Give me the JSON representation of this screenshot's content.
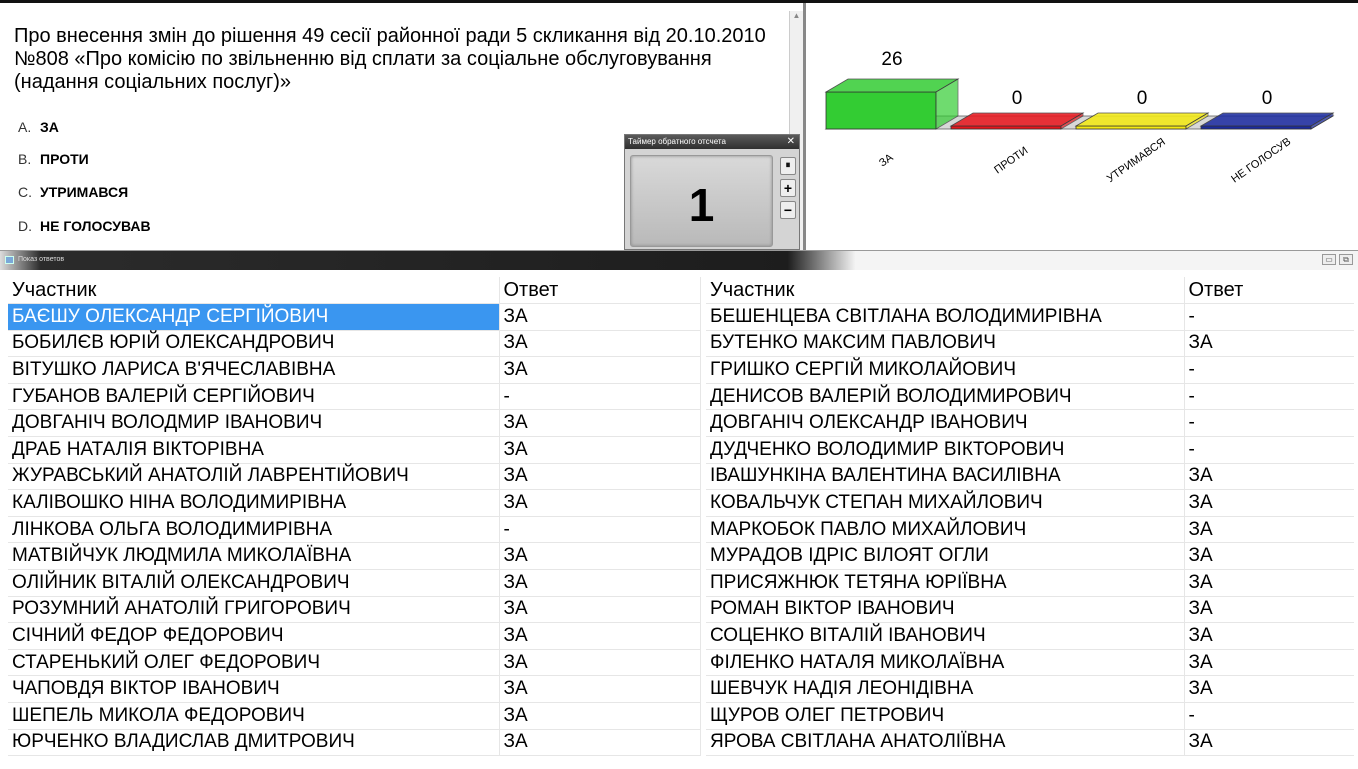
{
  "question": {
    "text": "Про внесення змін до рішення 49 сесії районної ради 5 скликання від 20.10.2010 №808 «Про комісію по звільненню від сплати за соціальне обслуговування (надання соціальних послуг)»",
    "options": [
      {
        "letter": "A.",
        "label": "ЗА"
      },
      {
        "letter": "B.",
        "label": "ПРОТИ"
      },
      {
        "letter": "C.",
        "label": "УТРИМАВСЯ"
      },
      {
        "letter": "D.",
        "label": "НЕ ГОЛОСУВАВ"
      }
    ]
  },
  "timer": {
    "title": "Таймер обратного отсчета",
    "close_icon": "✕",
    "value": "1",
    "pause_label": "⏸",
    "plus_label": "+",
    "minus_label": "−"
  },
  "chart_data": {
    "type": "bar",
    "categories": [
      "ЗА",
      "ПРОТИ",
      "УТРИМАВСЯ",
      "НЕ ГОЛОСУВ"
    ],
    "values": [
      26,
      0,
      0,
      0
    ],
    "colors": [
      "#33cc33",
      "#e8141b",
      "#f4ea10",
      "#1a2aa0"
    ],
    "data_labels": [
      "26",
      "0",
      "0",
      "0"
    ],
    "title": "",
    "xlabel": "",
    "ylabel": "",
    "ylim": [
      0,
      26
    ],
    "grid": false,
    "legend": "none",
    "style": "3d"
  },
  "answers_window": {
    "title": "Показ ответов",
    "minimize_icon": "minimize-icon",
    "maximize_icon": "maximize-icon",
    "columns": [
      "Участник",
      "Ответ",
      "Участник",
      "Ответ"
    ],
    "left_rows": [
      {
        "name": "БАЄШУ ОЛЕКСАНДР СЕРГІЙОВИЧ",
        "answer": "ЗА",
        "selected": true
      },
      {
        "name": "БОБИЛЄВ ЮРІЙ ОЛЕКСАНДРОВИЧ",
        "answer": "ЗА"
      },
      {
        "name": "ВІТУШКО ЛАРИСА В'ЯЧЕСЛАВІВНА",
        "answer": "ЗА"
      },
      {
        "name": "ГУБАНОВ ВАЛЕРІЙ СЕРГІЙОВИЧ",
        "answer": "-"
      },
      {
        "name": "ДОВГАНІЧ ВОЛОДМИР ІВАНОВИЧ",
        "answer": "ЗА"
      },
      {
        "name": "ДРАБ НАТАЛІЯ ВІКТОРІВНА",
        "answer": "ЗА"
      },
      {
        "name": "ЖУРАВСЬКИЙ АНАТОЛІЙ ЛАВРЕНТІЙОВИЧ",
        "answer": "ЗА"
      },
      {
        "name": "КАЛІВОШКО НІНА ВОЛОДИМИРІВНА",
        "answer": "ЗА"
      },
      {
        "name": "ЛІНКОВА ОЛЬГА ВОЛОДИМИРІВНА",
        "answer": "-"
      },
      {
        "name": "МАТВІЙЧУК ЛЮДМИЛА МИКОЛАЇВНА",
        "answer": "ЗА"
      },
      {
        "name": "ОЛІЙНИК ВІТАЛІЙ ОЛЕКСАНДРОВИЧ",
        "answer": "ЗА"
      },
      {
        "name": "РОЗУМНИЙ АНАТОЛІЙ ГРИГОРОВИЧ",
        "answer": "ЗА"
      },
      {
        "name": "СІЧНИЙ ФЕДОР ФЕДОРОВИЧ",
        "answer": "ЗА"
      },
      {
        "name": "СТАРЕНЬКИЙ ОЛЕГ ФЕДОРОВИЧ",
        "answer": "ЗА"
      },
      {
        "name": "ЧАПОВДЯ ВІКТОР ІВАНОВИЧ",
        "answer": "ЗА"
      },
      {
        "name": "ШЕПЕЛЬ МИКОЛА ФЕДОРОВИЧ",
        "answer": "ЗА"
      },
      {
        "name": "ЮРЧЕНКО ВЛАДИСЛАВ ДМИТРОВИЧ",
        "answer": "ЗА"
      }
    ],
    "right_rows": [
      {
        "name": "БЕШЕНЦЕВА СВІТЛАНА ВОЛОДИМИРІВНА",
        "answer": "-"
      },
      {
        "name": "БУТЕНКО МАКСИМ ПАВЛОВИЧ",
        "answer": "ЗА"
      },
      {
        "name": "ГРИШКО СЕРГІЙ МИКОЛАЙОВИЧ",
        "answer": "-"
      },
      {
        "name": "ДЕНИСОВ ВАЛЕРІЙ ВОЛОДИМИРОВИЧ",
        "answer": "-"
      },
      {
        "name": "ДОВГАНІЧ ОЛЕКСАНДР ІВАНОВИЧ",
        "answer": "-"
      },
      {
        "name": "ДУДЧЕНКО ВОЛОДИМИР ВІКТОРОВИЧ",
        "answer": "-"
      },
      {
        "name": "ІВАШУНКІНА ВАЛЕНТИНА ВАСИЛІВНА",
        "answer": "ЗА"
      },
      {
        "name": "КОВАЛЬЧУК СТЕПАН МИХАЙЛОВИЧ",
        "answer": "ЗА"
      },
      {
        "name": "МАРКОБОК ПАВЛО МИХАЙЛОВИЧ",
        "answer": "ЗА"
      },
      {
        "name": "МУРАДОВ ІДРІС ВІЛОЯТ ОГЛИ",
        "answer": "ЗА"
      },
      {
        "name": "ПРИСЯЖНЮК ТЕТЯНА ЮРІЇВНА",
        "answer": "ЗА"
      },
      {
        "name": "РОМАН ВІКТОР ІВАНОВИЧ",
        "answer": "ЗА"
      },
      {
        "name": "СОЦЕНКО ВІТАЛІЙ ІВАНОВИЧ",
        "answer": "ЗА"
      },
      {
        "name": "ФІЛЕНКО НАТАЛЯ МИКОЛАЇВНА",
        "answer": "ЗА"
      },
      {
        "name": "ШЕВЧУК НАДІЯ ЛЕОНІДІВНА",
        "answer": "ЗА"
      },
      {
        "name": "ЩУРОВ ОЛЕГ ПЕТРОВИЧ",
        "answer": "-"
      },
      {
        "name": "ЯРОВА СВІТЛАНА АНАТОЛІЇВНА",
        "answer": "ЗА"
      }
    ]
  }
}
